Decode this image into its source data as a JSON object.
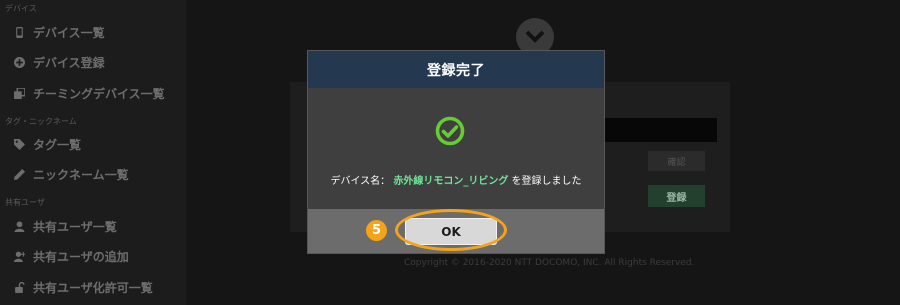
{
  "sidebar": {
    "section_device": "デバイス",
    "section_tag": "タグ・ニックネーム",
    "section_share": "共有ユーザ",
    "items": [
      {
        "label": "デバイス一覧",
        "icon": "phone-icon"
      },
      {
        "label": "デバイス登録",
        "icon": "plus-circle-icon"
      },
      {
        "label": "チーミングデバイス一覧",
        "icon": "clone-icon"
      },
      {
        "label": "タグ一覧",
        "icon": "tags-icon"
      },
      {
        "label": "ニックネーム一覧",
        "icon": "pencil-icon"
      },
      {
        "label": "共有ユーザ一覧",
        "icon": "user-icon"
      },
      {
        "label": "共有ユーザの追加",
        "icon": "user-plus-icon"
      },
      {
        "label": "共有ユーザ化許可一覧",
        "icon": "unlock-icon"
      }
    ]
  },
  "background": {
    "button_small": "確認",
    "button_register": "登録",
    "copyright": "Copyright © 2016-2020 NTT DOCOMO, INC. All Rights Reserved."
  },
  "modal": {
    "title": "登録完了",
    "msg_prefix": "デバイス名：",
    "device_name": "赤外線リモコン_リビング",
    "msg_suffix": "を登録しました",
    "ok_label": "OK",
    "step_number": "5",
    "success_color": "#66cc33",
    "highlight_color": "#f5a31a"
  }
}
